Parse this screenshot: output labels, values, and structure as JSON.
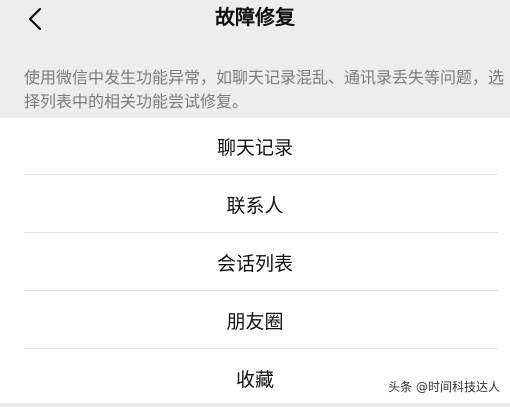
{
  "header": {
    "back_icon": "chevron-left-icon",
    "title": "故障修复"
  },
  "description": "使用微信中发生功能异常，如聊天记录混乱、通讯录丢失等问题，选择列表中的相关功能尝试修复。",
  "menu": {
    "items": [
      {
        "label": "聊天记录"
      },
      {
        "label": "联系人"
      },
      {
        "label": "会话列表"
      },
      {
        "label": "朋友圈"
      },
      {
        "label": "收藏"
      }
    ]
  },
  "watermark": "头条 @时间科技达人",
  "colors": {
    "background": "#ededed",
    "list_background": "#ffffff",
    "description_text": "#7c7c7c",
    "divider": "#e2e2e2"
  }
}
